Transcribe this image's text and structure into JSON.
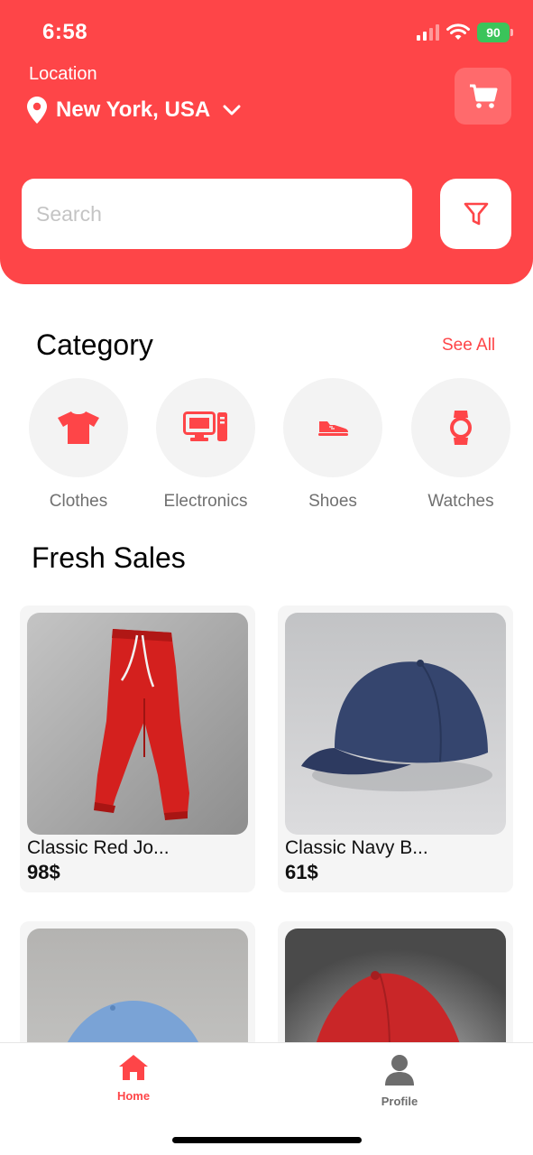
{
  "status_bar": {
    "time": "6:58",
    "battery": "90"
  },
  "header": {
    "location_label": "Location",
    "location_value": "New York, USA",
    "search_placeholder": "Search",
    "accent_color": "#fe4548"
  },
  "category": {
    "title": "Category",
    "see_all": "See All",
    "items": [
      {
        "label": "Clothes",
        "icon": "tshirt-icon"
      },
      {
        "label": "Electronics",
        "icon": "computer-icon"
      },
      {
        "label": "Shoes",
        "icon": "shoe-icon"
      },
      {
        "label": "Watches",
        "icon": "watch-icon"
      }
    ]
  },
  "fresh_sales": {
    "title": "Fresh Sales",
    "products": [
      {
        "name": "Classic Red Jo...",
        "price": "98$"
      },
      {
        "name": "Classic Navy B...",
        "price": "61$"
      },
      {
        "name": "",
        "price": ""
      },
      {
        "name": "",
        "price": ""
      }
    ]
  },
  "bottom_nav": {
    "items": [
      {
        "label": "Home",
        "icon": "home-icon",
        "active": true
      },
      {
        "label": "Profile",
        "icon": "person-icon",
        "active": false
      }
    ]
  }
}
